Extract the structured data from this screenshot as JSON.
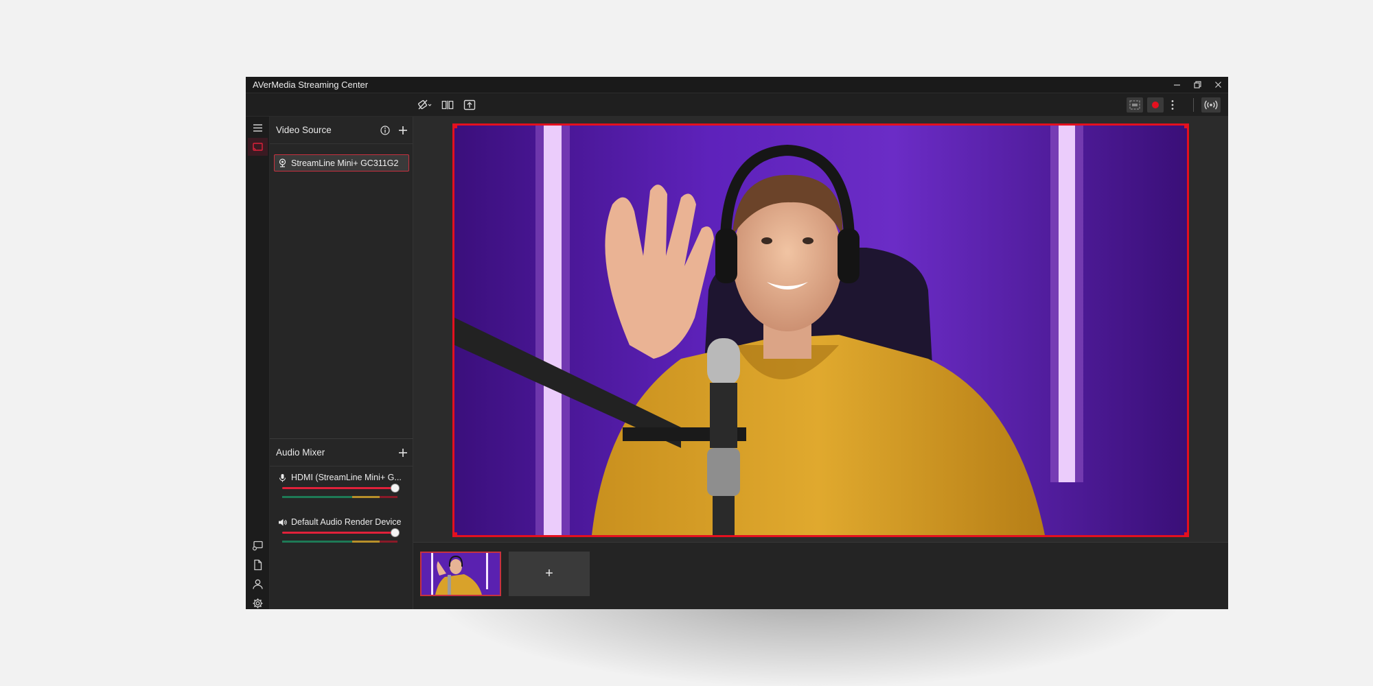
{
  "app": {
    "title": "AVerMedia Streaming Center"
  },
  "video_source": {
    "header": "Video Source",
    "items": [
      {
        "label": "StreamLine Mini+ GC311G2",
        "icon": "webcam-icon",
        "selected": true
      }
    ]
  },
  "audio_mixer": {
    "header": "Audio Mixer",
    "channels": [
      {
        "label": "HDMI (StreamLine Mini+ G...",
        "icon": "microphone-icon",
        "volume": 1.0
      },
      {
        "label": "Default Audio Render Device",
        "icon": "speaker-icon",
        "volume": 1.0
      }
    ]
  },
  "scenes": {
    "add_label": "+"
  },
  "theme": {
    "accent": "#e4101f",
    "selected_border": "#c8313f",
    "window_bg": "#1d1d1d",
    "panel_bg": "#262626",
    "meter_green": "#1e7a56",
    "meter_yellow": "#b8902a",
    "meter_red": "#8a1a28"
  }
}
